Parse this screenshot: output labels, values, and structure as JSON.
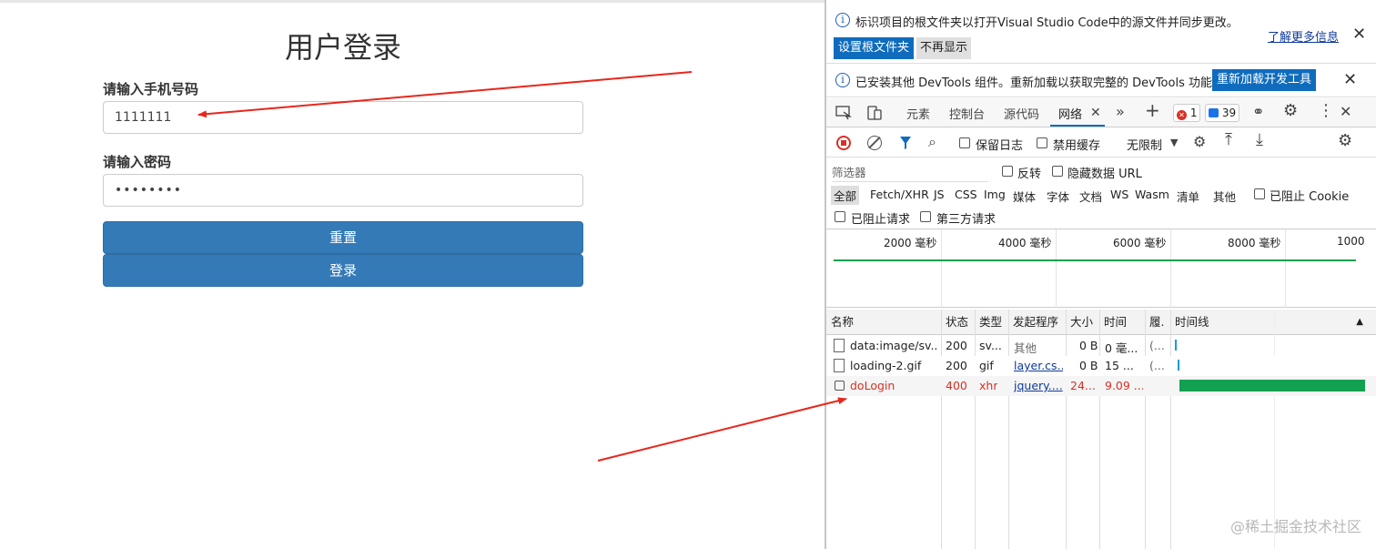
{
  "page": {
    "title": "用户登录",
    "phone_label": "请输入手机号码",
    "phone_value": "1111111",
    "password_label": "请输入密码",
    "password_value": "••••••••",
    "reset_label": "重置",
    "login_label": "登录"
  },
  "infobar1": {
    "text": "标识项目的根文件夹以打开Visual Studio Code中的源文件并同步更改。",
    "learn_more": "了解更多信息",
    "set_root_btn": "设置根文件夹",
    "dont_show_btn": "不再显示"
  },
  "infobar2": {
    "text": "已安装其他 DevTools 组件。重新加载以获取完整的 DevTools 功能。",
    "reload_btn": "重新加载开发工具"
  },
  "tabs": {
    "elements": "元素",
    "console": "控制台",
    "sources": "源代码",
    "network": "网络",
    "errors_count": "1",
    "messages_count": "39"
  },
  "network_toolbar": {
    "preserve_log": "保留日志",
    "disable_cache": "禁用缓存",
    "throttle": "无限制"
  },
  "filter": {
    "placeholder": "筛选器",
    "invert": "反转",
    "hide_data_urls": "隐藏数据 URL",
    "types": [
      "全部",
      "Fetch/XHR",
      "JS",
      "CSS",
      "Img",
      "媒体",
      "字体",
      "文档",
      "WS",
      "Wasm",
      "清单",
      "其他"
    ],
    "blocked_cookies": "已阻止 Cookie",
    "blocked_requests": "已阻止请求",
    "third_party": "第三方请求"
  },
  "overview": {
    "ticks": [
      "2000  毫秒",
      "4000  毫秒",
      "6000  毫秒",
      "8000  毫秒",
      "1000"
    ]
  },
  "table": {
    "headers": [
      "名称",
      "状态",
      "类型",
      "发起程序",
      "大小",
      "时间",
      "履.",
      "时间线"
    ],
    "rows": [
      {
        "name": "data:image/sv...",
        "status": "200",
        "type": "sv...",
        "initiator": "其他",
        "size": "0 B",
        "time": "0  毫...",
        "fulfilled": "(..."
      },
      {
        "name": "loading-2.gif",
        "status": "200",
        "type": "gif",
        "initiator": "layer.cs...",
        "size": "0 B",
        "time": "15  ...",
        "fulfilled": "(..."
      },
      {
        "name": "doLogin",
        "status": "400",
        "type": "xhr",
        "initiator": "jquery....",
        "size": "24...",
        "time": "9.09 ...",
        "fulfilled": ""
      }
    ]
  },
  "watermark": "@稀土掘金技术社区",
  "colors": {
    "primary_button": "#337ab7",
    "devtools_accent": "#0f6cbd",
    "error_text": "#d93025",
    "waterfall_green": "#12a150",
    "arrow_red": "#e8261c"
  }
}
